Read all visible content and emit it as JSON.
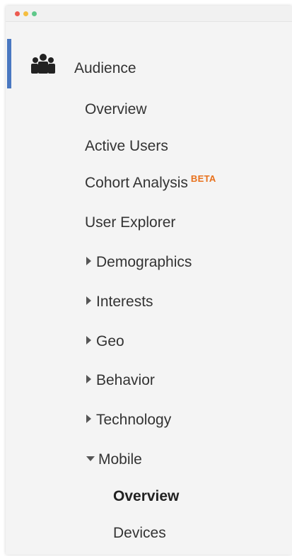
{
  "window": {
    "controls": [
      "close",
      "minimize",
      "maximize"
    ]
  },
  "section": {
    "label": "Audience",
    "icon": "people-group-icon",
    "accent_color": "#4a78c1"
  },
  "nav": {
    "overview": "Overview",
    "active_users": "Active Users",
    "cohort_analysis": "Cohort Analysis",
    "cohort_badge": "BETA",
    "user_explorer": "User Explorer",
    "demographics": "Demographics",
    "interests": "Interests",
    "geo": "Geo",
    "behavior": "Behavior",
    "technology": "Technology",
    "mobile": "Mobile",
    "mobile_children": {
      "overview": "Overview",
      "devices": "Devices"
    }
  },
  "colors": {
    "badge": "#e8711c",
    "text": "#333333",
    "panel_bg": "#f4f4f4"
  }
}
